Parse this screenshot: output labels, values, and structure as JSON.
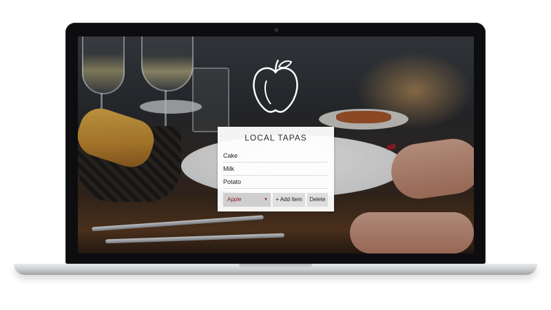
{
  "app": {
    "title": "LOCAL TAPAS",
    "logo_icon": "apple-outline-icon",
    "items": [
      {
        "label": "Cake"
      },
      {
        "label": "Milk"
      },
      {
        "label": "Potato"
      }
    ],
    "select": {
      "value": "Apple"
    },
    "buttons": {
      "add_label": "+ Add Item",
      "delete_label": "Delete"
    }
  },
  "colors": {
    "select_text": "#8b1e2c",
    "panel_bg": "#ffffff",
    "button_bg": "#dedede"
  }
}
